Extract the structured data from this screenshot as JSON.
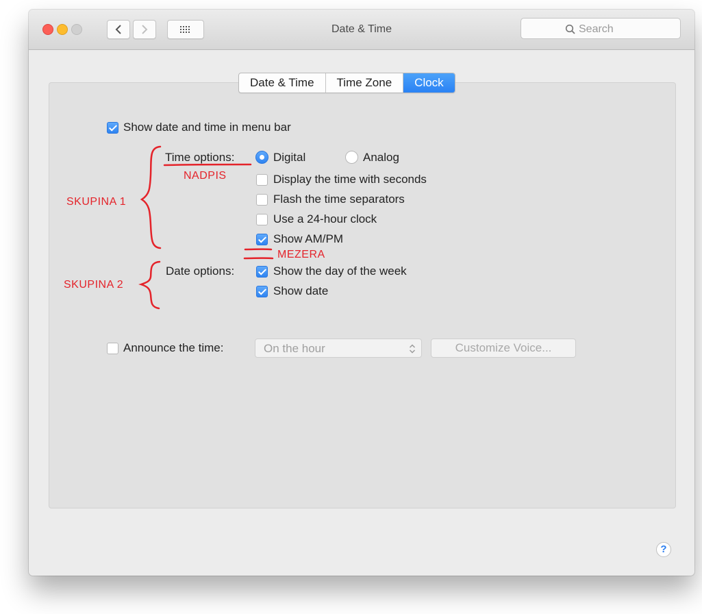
{
  "window": {
    "title": "Date & Time",
    "search_placeholder": "Search"
  },
  "tabs": [
    {
      "label": "Date & Time",
      "active": false
    },
    {
      "label": "Time Zone",
      "active": false
    },
    {
      "label": "Clock",
      "active": true
    }
  ],
  "clock": {
    "show_menu_bar": {
      "label": "Show date and time in menu bar",
      "checked": true
    },
    "time_options": {
      "heading": "Time options:",
      "digital": {
        "label": "Digital",
        "selected": true
      },
      "analog": {
        "label": "Analog",
        "selected": false
      },
      "seconds": {
        "label": "Display the time with seconds",
        "checked": false
      },
      "flash": {
        "label": "Flash the time separators",
        "checked": false
      },
      "h24": {
        "label": "Use a 24-hour clock",
        "checked": false
      },
      "ampm": {
        "label": "Show AM/PM",
        "checked": true
      }
    },
    "date_options": {
      "heading": "Date options:",
      "day_of_week": {
        "label": "Show the day of the week",
        "checked": true
      },
      "show_date": {
        "label": "Show date",
        "checked": true
      }
    },
    "announce": {
      "label": "Announce the time:",
      "checked": false,
      "interval": "On the hour",
      "customize_label": "Customize Voice..."
    }
  },
  "help_label": "?",
  "annotations": {
    "nadpis": "NADPIS",
    "skupina1": "SKUPINA 1",
    "skupina2": "SKUPINA 2",
    "mezera": "MEZERA",
    "color": "#e4232a"
  },
  "colors": {
    "accent": "#2f84f1",
    "close": "#fc5f57",
    "minimize": "#fdbc2e",
    "zoom_disabled": "#d0d0d0"
  }
}
